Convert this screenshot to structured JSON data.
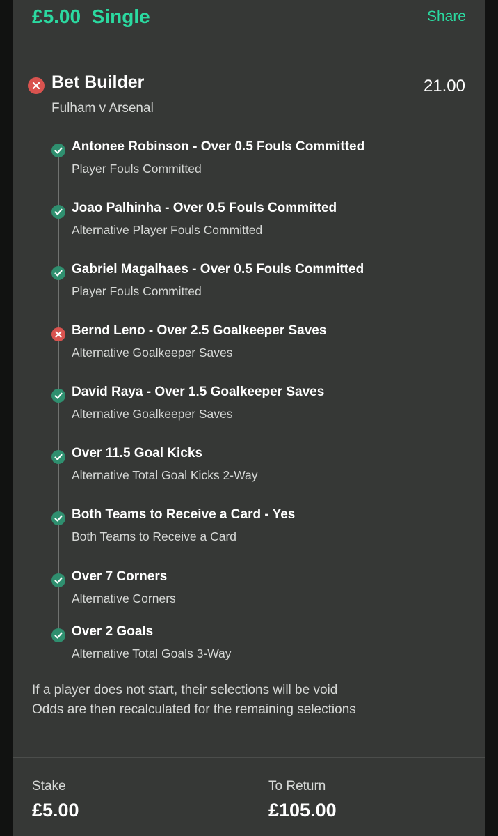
{
  "header": {
    "stake_amount": "£5.00",
    "bet_type": "Single",
    "share_label": "Share"
  },
  "bet": {
    "title": "Bet Builder",
    "odds": "21.00",
    "fixture": "Fulham v Arsenal",
    "status": "lost",
    "legs": [
      {
        "selection": "Antonee Robinson - Over 0.5 Fouls Committed",
        "market": "Player Fouls Committed",
        "status": "won"
      },
      {
        "selection": "Joao Palhinha - Over 0.5 Fouls Committed",
        "market": "Alternative Player Fouls Committed",
        "status": "won"
      },
      {
        "selection": "Gabriel Magalhaes - Over 0.5 Fouls Committed",
        "market": "Player Fouls Committed",
        "status": "won"
      },
      {
        "selection": "Bernd Leno - Over 2.5 Goalkeeper Saves",
        "market": "Alternative Goalkeeper Saves",
        "status": "lost"
      },
      {
        "selection": "David Raya - Over 1.5 Goalkeeper Saves",
        "market": "Alternative Goalkeeper Saves",
        "status": "won"
      },
      {
        "selection": "Over 11.5 Goal Kicks",
        "market": "Alternative Total Goal Kicks 2-Way",
        "status": "won"
      },
      {
        "selection": "Both Teams to Receive a Card - Yes",
        "market": "Both Teams to Receive a Card",
        "status": "won"
      },
      {
        "selection": "Over 7 Corners",
        "market": "Alternative Corners",
        "status": "won"
      },
      {
        "selection": "Over 2 Goals",
        "market": "Alternative Total Goals 3-Way",
        "status": "won"
      }
    ],
    "note_line1": "If a player does not start, their selections will be void",
    "note_line2": "Odds are then recalculated for the remaining selections"
  },
  "footer": {
    "stake_label": "Stake",
    "stake_value": "£5.00",
    "return_label": "To Return",
    "return_value": "£105.00"
  },
  "colors": {
    "accent": "#2bd9a0",
    "won": "#2f8f6f",
    "lost": "#d9534f",
    "card_bg": "#363836",
    "page_bg": "#111211"
  }
}
